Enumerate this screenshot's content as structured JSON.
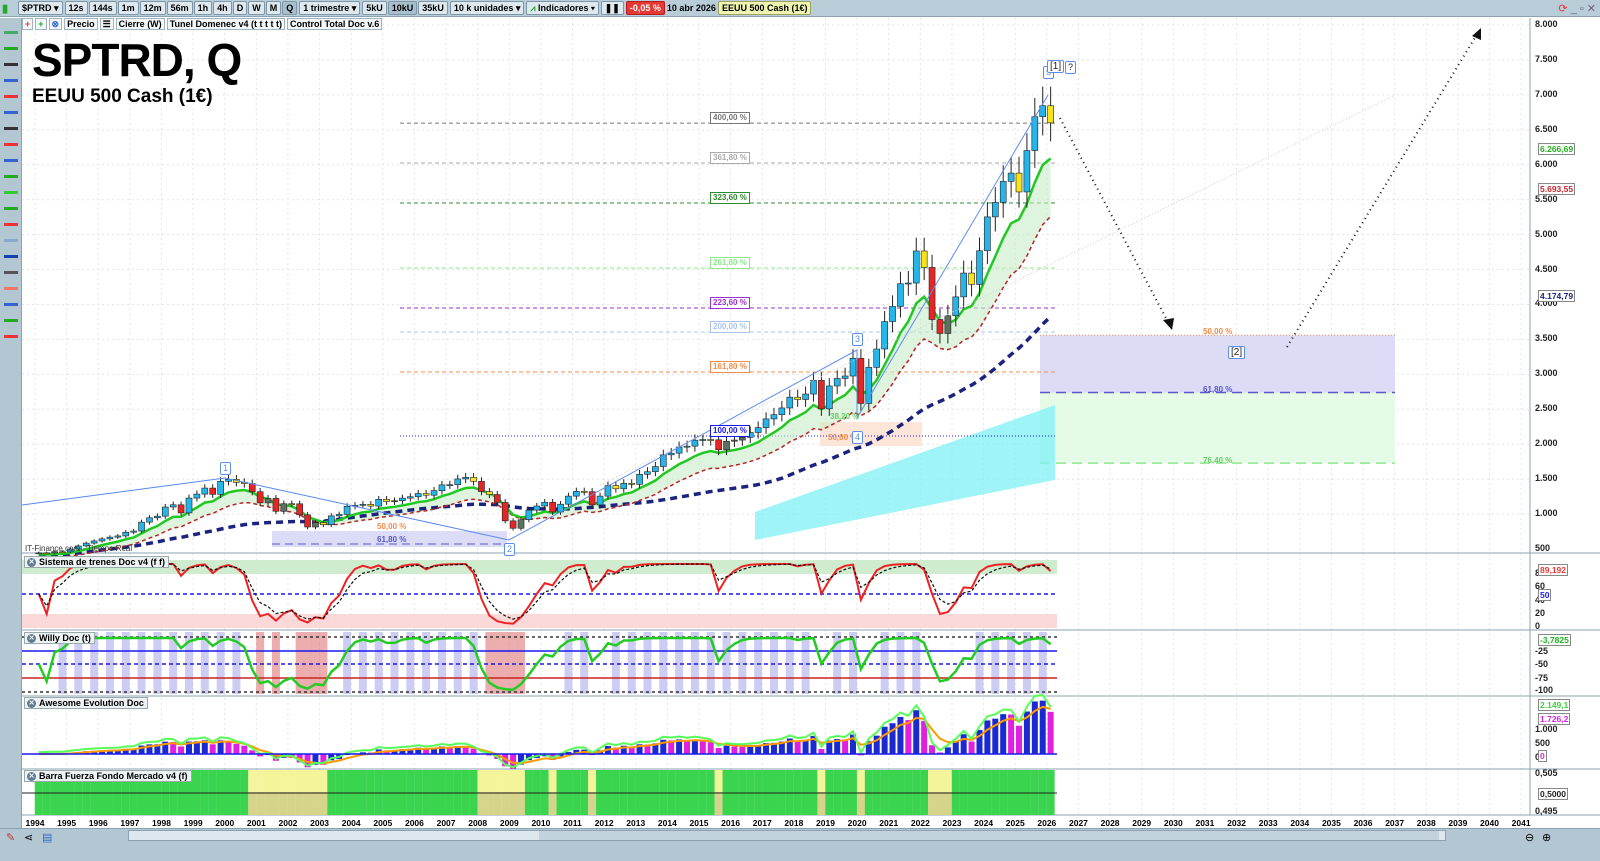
{
  "toolbar": {
    "symbol": "$PTRD",
    "timeframes": [
      "12s",
      "144s",
      "1m",
      "12m",
      "56m",
      "1h",
      "4h",
      "D",
      "W",
      "M",
      "Q"
    ],
    "active_timeframe": "Q",
    "period": "1 trimestre",
    "units": [
      "5kU",
      "10kU",
      "35kU"
    ],
    "active_unit": "10kU",
    "units_select": "10 k unidades",
    "indicators_label": "Indicadores",
    "change": "-0,05 %",
    "date": "10 abr 2026",
    "instrument": "EEUU 500 Cash (1€)"
  },
  "toolbar2": {
    "items": [
      "Precio",
      "Cierre (W)",
      "Tunel Domenec v4 (t t t t t)",
      "Control Total Doc v.6"
    ]
  },
  "header": {
    "title": "SPTRD, Q",
    "subtitle": "EEUU 500 Cash (1€)",
    "watermark": "IT-Finance.com - Tiempo Real"
  },
  "panels": [
    "Sistema de trenes Doc v4 (f f)",
    "Willy Doc (t)",
    "Awesome Evolution Doc",
    "Barra Fuerza Fondo Mercado v4 (f)"
  ],
  "axis": {
    "price_ticks": [
      "8.000",
      "7.500",
      "7.000",
      "6.500",
      "6.000",
      "5.500",
      "5.000",
      "4.500",
      "4.000",
      "3.500",
      "3.000",
      "2.500",
      "2.000",
      "1.500",
      "1.000",
      "500"
    ],
    "trenes_ticks": [
      "80",
      "60",
      "40",
      "20",
      "0"
    ],
    "willy_ticks": [
      "-25",
      "-50",
      "-75",
      "-100"
    ],
    "awesome_ticks": [
      "1.000",
      "500",
      "0"
    ],
    "barra_ticks": [
      "0,505",
      "0,495"
    ],
    "years": [
      "1994",
      "1995",
      "1996",
      "1997",
      "1998",
      "1999",
      "2000",
      "2001",
      "2002",
      "2003",
      "2004",
      "2005",
      "2006",
      "2007",
      "2008",
      "2009",
      "2010",
      "2011",
      "2012",
      "2013",
      "2014",
      "2015",
      "2016",
      "2017",
      "2018",
      "2019",
      "2020",
      "2021",
      "2022",
      "2023",
      "2024",
      "2025",
      "2026",
      "2027",
      "2028",
      "2029",
      "2030",
      "2031",
      "2032",
      "2033",
      "2034",
      "2035",
      "2036",
      "2037",
      "2038",
      "2039",
      "2040",
      "2041"
    ]
  },
  "tags": {
    "green_ma": "6.266,69",
    "red_ma": "5.693,55",
    "blue_ma": "4.174,79",
    "trenes": "89,192",
    "trenes_50": "50",
    "willy": "-3,7825",
    "awesome_1": "2.149,1",
    "awesome_2": "1.726,2",
    "awesome_0": "0",
    "barra": "0,5000"
  },
  "chart_data": {
    "type": "candlestick",
    "title": "SPTRD, Q",
    "timeframe": "quarterly",
    "start": "1994Q1",
    "ylim": [
      500,
      8000
    ],
    "closes": [
      445,
      444,
      462,
      459,
      500,
      544,
      584,
      615,
      645,
      670,
      687,
      740,
      757,
      885,
      947,
      970,
      1101,
      1133,
      1017,
      1229,
      1286,
      1372,
      1282,
      1469,
      1498,
      1454,
      1436,
      1320,
      1160,
      1224,
      1040,
      1148,
      1147,
      989,
      815,
      879,
      848,
      974,
      995,
      1111,
      1126,
      1140,
      1114,
      1211,
      1180,
      1191,
      1228,
      1248,
      1294,
      1270,
      1335,
      1418,
      1420,
      1503,
      1526,
      1468,
      1322,
      1280,
      1166,
      903,
      797,
      919,
      1057,
      1115,
      1169,
      1030,
      1141,
      1257,
      1325,
      1320,
      1131,
      1257,
      1408,
      1362,
      1440,
      1426,
      1569,
      1606,
      1681,
      1848,
      1872,
      1960,
      1972,
      2058,
      2067,
      2063,
      1920,
      2043,
      2059,
      2098,
      2168,
      2238,
      2362,
      2423,
      2519,
      2673,
      2640,
      2718,
      2913,
      2506,
      2834,
      2941,
      2976,
      3230,
      2584,
      3100,
      3363,
      3756,
      3972,
      4297,
      4307,
      4766,
      4530,
      3785,
      3585,
      3839,
      4109,
      4450,
      4288,
      4769,
      5254,
      5460,
      5762,
      5881,
      5611,
      6204,
      6688,
      6845,
      6600
    ],
    "fib_extensions": [
      {
        "label": "400,00 %",
        "price": 6597,
        "color": "#777777"
      },
      {
        "label": "361,80 %",
        "price": 6025,
        "color": "#aaaaaa"
      },
      {
        "label": "323,60 %",
        "price": 5453,
        "color": "#2e8b2e"
      },
      {
        "label": "261,80 %",
        "price": 4523,
        "color": "#8ee88e"
      },
      {
        "label": "223,60 %",
        "price": 3950,
        "color": "#9b30d0"
      },
      {
        "label": "200,00 %",
        "price": 3606,
        "color": "#a8c4ee"
      },
      {
        "label": "161,80 %",
        "price": 3033,
        "color": "#f28c4a"
      },
      {
        "label": "100,00 %",
        "price": 2117,
        "color": "#1a1aee"
      }
    ],
    "retracement_zone": [
      {
        "label": "50,00 %",
        "price": 3560
      },
      {
        "label": "61,80 %",
        "price": 2740
      },
      {
        "label": "76,40 %",
        "price": 1730
      }
    ],
    "small_zones": [
      {
        "label": "50,00 %"
      },
      {
        "label": "61,80 %"
      },
      {
        "label": "38,20 %"
      },
      {
        "label": "50,00 %"
      }
    ],
    "waves": [
      "1",
      "2",
      "3",
      "4",
      "5",
      "[1]",
      "?",
      "[2]"
    ]
  }
}
